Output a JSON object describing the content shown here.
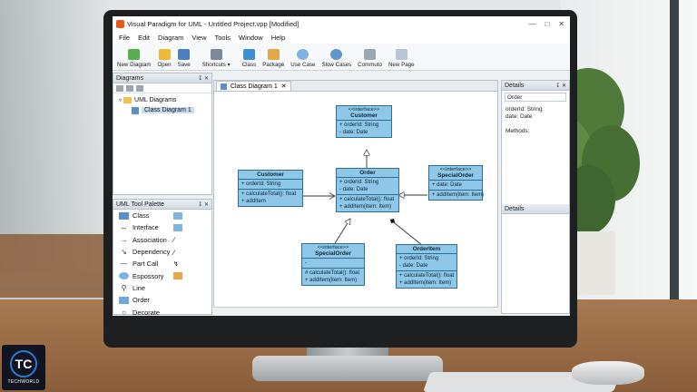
{
  "window": {
    "title": "Visual Paradigm for UML - Untitled Project.vpp [Modified]"
  },
  "menu": [
    "File",
    "Edit",
    "Diagram",
    "View",
    "Tools",
    "Window",
    "Help"
  ],
  "toolbar": {
    "new_diagram": "New Diagram",
    "open": "Open",
    "save": "Save",
    "shortcuts": "Shortcuts",
    "class": "Class",
    "package": "Package",
    "use_case": "Use Case",
    "slow_cases": "Slow Cases",
    "commuto": "Commuto",
    "new_page": "New Page"
  },
  "diagrams_panel": {
    "title": "Diagrams",
    "pin": "↧ ✕",
    "root": "UML Diagrams",
    "child": "Class Diagram 1"
  },
  "palette": {
    "title": "UML Tool Palette",
    "pin": "↧ ✕",
    "items": [
      "Class",
      "Interface",
      "Association",
      "Dependency",
      "Part Call",
      "Espossory",
      "Line",
      "Order",
      "Decorate"
    ]
  },
  "canvas": {
    "tab": "Class Diagram 1",
    "tab_close": "✕",
    "classes": {
      "customer_top": {
        "stereotype": "<<interface>>",
        "name": "Customer",
        "attrs": [
          "+ orderId: String",
          "- date: Date"
        ]
      },
      "customer_left": {
        "name": "Customer",
        "attrs": [
          "+ orderId: String"
        ],
        "ops": [
          "+ calculateTotal(): float",
          "+ addItem"
        ]
      },
      "order": {
        "name": "Order",
        "attrs": [
          "+ orderId: String",
          "- date: Date"
        ],
        "ops": [
          "+ calculateTotal(): float",
          "+ addItem(item: Item)"
        ]
      },
      "special_right": {
        "stereotype": "<<interface>>",
        "name": "SpecialOrder",
        "attrs": [
          "+ date: Date"
        ],
        "ops": [
          "+ addItem(item: Item)"
        ]
      },
      "special_bottom": {
        "stereotype": "<<interface>>",
        "name": "SpecialOrder",
        "attrs": [
          "-"
        ],
        "ops": [
          "# calculateTotal(): float",
          "+ addItem(item: Item)"
        ]
      },
      "order_item": {
        "name": "OrderItem",
        "attrs": [
          "+ orderId: String",
          "- date: Date"
        ],
        "ops": [
          "+ calculateTotal(): float",
          "+ addItem(item: Item)"
        ]
      }
    }
  },
  "details": {
    "title": "Details",
    "pin": "↧ ✕",
    "name_value": "Order",
    "attrs": [
      "orderId: String",
      "date: Date"
    ],
    "methods_label": "Methods:",
    "footer_title": "Details"
  },
  "logo": {
    "mark": "TC",
    "caption": "TECHWORLD"
  }
}
